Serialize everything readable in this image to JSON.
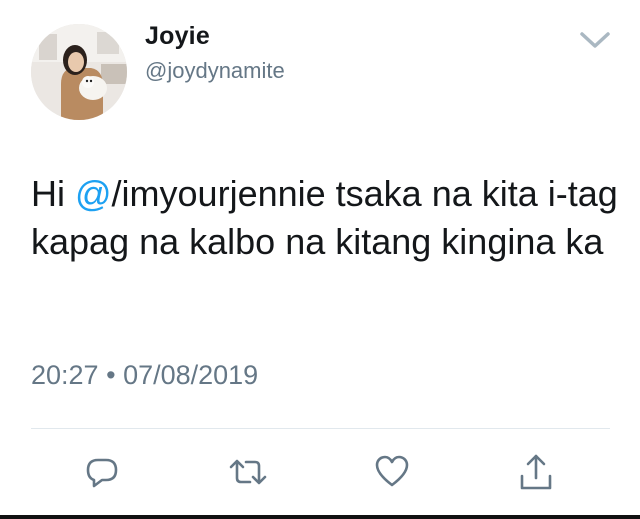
{
  "tweet": {
    "display_name": "Joyie",
    "handle": "@joydynamite",
    "text_prefix": "Hi ",
    "mention": "@",
    "text_rest": "/imyourjennie tsaka na kita i-tag kapag na kalbo na kitang kingina ka",
    "time": "20:27",
    "separator": "•",
    "date": "07/08/2019"
  },
  "actions": [
    {
      "icon": "reply-icon"
    },
    {
      "icon": "retweet-icon"
    },
    {
      "icon": "like-icon"
    },
    {
      "icon": "share-icon"
    }
  ],
  "colors": {
    "accent": "#1da1f2",
    "muted": "#657786",
    "text": "#14171a",
    "divider": "#e1e8ed"
  }
}
